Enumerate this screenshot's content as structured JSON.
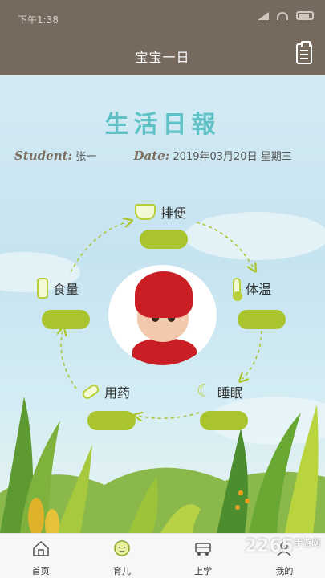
{
  "status_bar": {
    "time": "下午1:38"
  },
  "header": {
    "title": "宝宝一日"
  },
  "report": {
    "title": "生活日報",
    "student_label": "Student:",
    "student_name": "张一",
    "date_label": "Date:",
    "date_value": "2019年03月20日 星期三"
  },
  "cycle_items": {
    "stool": {
      "label": "排便",
      "icon": "diaper-icon",
      "value": ""
    },
    "temperature": {
      "label": "体温",
      "icon": "thermometer-icon",
      "value": ""
    },
    "sleep": {
      "label": "睡眠",
      "icon": "moon-icon",
      "value": ""
    },
    "medicine": {
      "label": "用药",
      "icon": "pill-icon",
      "value": ""
    },
    "food": {
      "label": "食量",
      "icon": "bottle-icon",
      "value": ""
    }
  },
  "tabs": [
    {
      "label": "首页",
      "icon": "home-icon"
    },
    {
      "label": "育儿",
      "icon": "baby-face-icon"
    },
    {
      "label": "上学",
      "icon": "school-bus-icon"
    },
    {
      "label": "我的",
      "icon": "profile-icon"
    }
  ],
  "watermark": {
    "text": "2265",
    "suffix": "手游网",
    "domain": ".com"
  },
  "colors": {
    "header_bg": "#766a5f",
    "accent_green": "#a9c42d",
    "title_teal": "#5fc2c6"
  }
}
